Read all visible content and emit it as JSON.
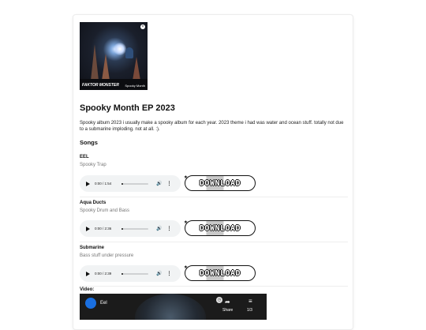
{
  "cover": {
    "alt": "Spooky Month EP 2023 album cover",
    "brand_left": "FAKTOR MONSTER",
    "brand_right": "Spooky Month",
    "close_glyph": "×"
  },
  "album": {
    "title": "Spooky Month EP 2023",
    "description": "Spooky album 2023 i usually make a spooky album for each year. 2023 theme i had was water and ocean stuff. totally not due to a submarine imploding. not at all. :)."
  },
  "songs_heading": "Songs",
  "download_label": "DOWNLOAD",
  "songs": [
    {
      "name": "EEL",
      "genre": "Spooky Trap",
      "time": "0:00 / 1:54",
      "progress": 0
    },
    {
      "name": "Aqua Ducts",
      "genre": "Spooky Drum and Bass",
      "time": "0:00 / 2:36",
      "progress": 0
    },
    {
      "name": "Submarine",
      "genre": "Bass stuff under pressure",
      "time": "0:00 / 2:39",
      "progress": 0
    }
  ],
  "video": {
    "label": "Video:",
    "title": "Eel",
    "share_label": "Share",
    "playlist_count": "1/3"
  },
  "icons": {
    "play": "play-icon",
    "volume": "volume-icon",
    "more": "more-vert-icon",
    "share": "share-icon",
    "playlist": "playlist-icon"
  }
}
